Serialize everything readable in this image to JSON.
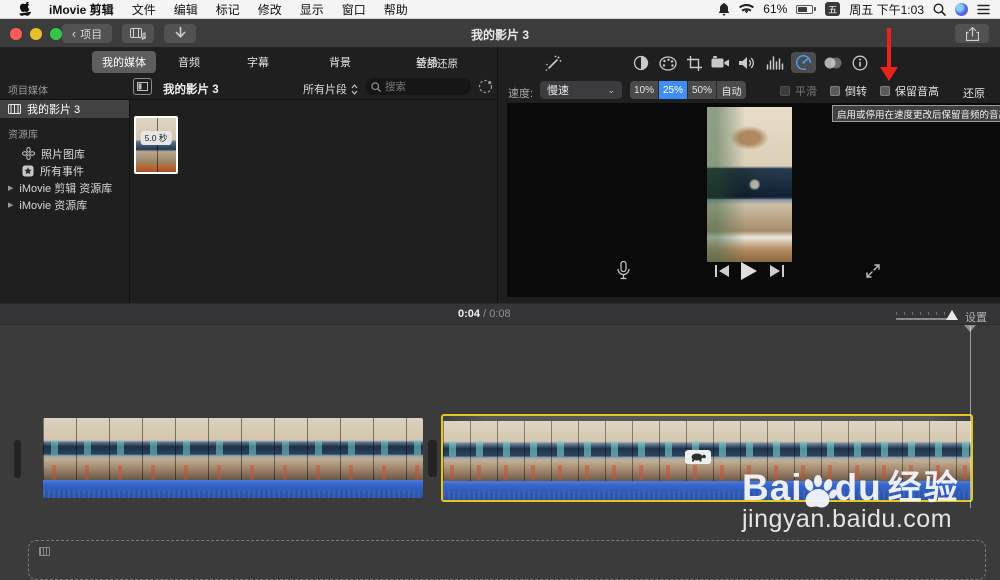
{
  "menu_bar": {
    "items": [
      "iMovie 剪辑",
      "文件",
      "编辑",
      "标记",
      "修改",
      "显示",
      "窗口",
      "帮助"
    ],
    "status": {
      "battery_pct": "61%",
      "input_method": "五",
      "clock": "周五 下午1:03"
    }
  },
  "title_bar": {
    "back_label": "项目",
    "title": "我的影片 3"
  },
  "media_panel": {
    "tabs": [
      {
        "label": "我的媒体",
        "selected": true
      },
      {
        "label": "音频",
        "selected": false
      },
      {
        "label": "字幕",
        "selected": false
      },
      {
        "label": "背景",
        "selected": false
      },
      {
        "label": "转场",
        "selected": false
      }
    ]
  },
  "sidebar": {
    "header": "项目媒体",
    "project_item": "我的影片 3",
    "library_header": "资源库",
    "items": [
      "照片图库",
      "所有事件",
      "iMovie 剪辑 资源库",
      "iMovie 资源库"
    ]
  },
  "browser": {
    "title": "我的影片 3",
    "filter": "所有片段",
    "search_placeholder": "搜索",
    "clip_duration": "5.0 秒"
  },
  "adjust": {
    "reset_all": "全部还原"
  },
  "speed": {
    "label": "速度:",
    "preset": "慢速",
    "segments": [
      "10%",
      "25%",
      "50%",
      "自动"
    ],
    "selected_segment": "25%",
    "smooth_label": "平滑",
    "reverse_label": "倒转",
    "preserve_pitch_label": "保留音高",
    "reset_label": "还原"
  },
  "tooltip": {
    "text": "启用或停用在速度更改后保留音频的音高"
  },
  "timeline": {
    "current_time": "0:04",
    "separator": "/",
    "total_time": "0:08",
    "settings_label": "设置"
  },
  "watermark": {
    "brand_part1": "Bai",
    "brand_part2": "du",
    "brand_part3": "经验",
    "url": "jingyan.baidu.com"
  },
  "icons": {
    "slow_speed_badge": "turtle-icon",
    "speed_tool": "speedometer-icon",
    "selected_tool_color": "#3e8ef7"
  },
  "colors": {
    "accent_blue": "#3e8ef7",
    "selection_yellow": "#e5c522",
    "audio_waveform_blue": "#3263c8",
    "annotation_red": "#e8231a"
  }
}
